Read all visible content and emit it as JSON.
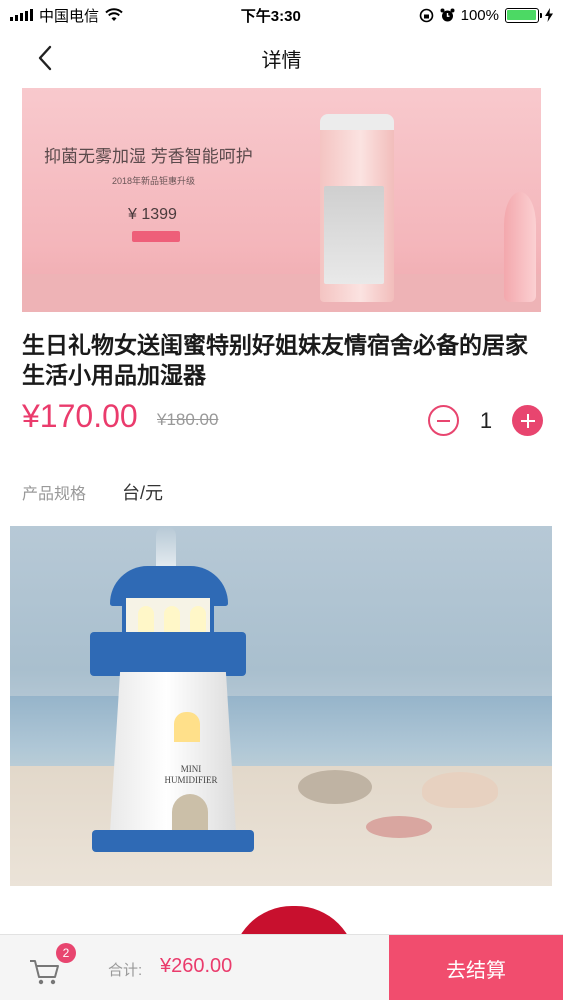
{
  "status_bar": {
    "carrier": "中国电信",
    "time": "下午3:30",
    "battery": "100%"
  },
  "nav": {
    "title": "详情",
    "back_icon": "chevron-left-icon"
  },
  "banner": {
    "headline": "抑菌无雾加湿 芳香智能呵护",
    "subline": "2018年新品钜惠升级",
    "price": "¥ 1399"
  },
  "product": {
    "title": "生日礼物女送闺蜜特别好姐妹友情宿舍必备的居家生活小用品加湿器",
    "price": "¥170.00",
    "original_price": "¥180.00",
    "quantity": "1",
    "spec_label": "产品规格",
    "spec_value": "台/元"
  },
  "detail_image": {
    "label_text": "MINI HUMIDIFIER"
  },
  "bottom_bar": {
    "cart_icon": "cart-icon",
    "cart_count": "2",
    "total_label": "合计:",
    "total_value": "¥260.00",
    "checkout_label": "去结算"
  },
  "colors": {
    "accent": "#ea3b6c",
    "checkout": "#f14d6e",
    "battery": "#4cd964"
  }
}
